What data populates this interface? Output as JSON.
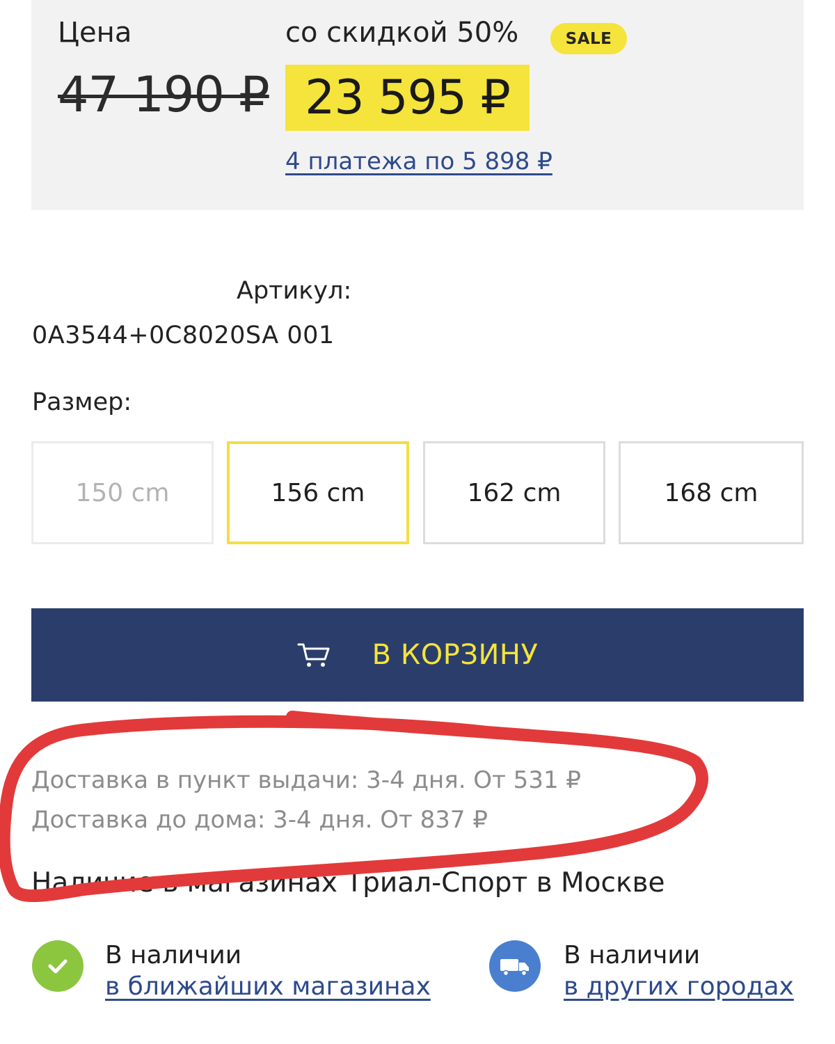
{
  "price": {
    "label": "Цена",
    "old": "47 190 ₽",
    "discount_label": "со скидкой 50%",
    "sale_badge": "SALE",
    "new": "23 595 ₽",
    "installment": "4 платежа по 5 898 ₽"
  },
  "sku": {
    "label": "Артикул:",
    "value": "0A3544+0C8020SA 001"
  },
  "sizes": {
    "label": "Размер:",
    "options": [
      {
        "label": "150 cm",
        "state": "unavailable"
      },
      {
        "label": "156 cm",
        "state": "selected"
      },
      {
        "label": "162 cm",
        "state": "available"
      },
      {
        "label": "168 cm",
        "state": "available"
      }
    ]
  },
  "cart": {
    "label": "В КОРЗИНУ",
    "icon": "cart-icon"
  },
  "delivery": {
    "pickup": "Доставка в пункт выдачи: 3-4 дня. От 531 ₽",
    "home": "Доставка до дома: 3-4 дня. От 837 ₽"
  },
  "stores_heading": "Наличие в магазинах Триал-Спорт в Москве",
  "availability": [
    {
      "icon": "check-circle-icon",
      "title": "В наличии",
      "link": "в ближайших магазинах"
    },
    {
      "icon": "delivery-truck-icon",
      "title": "В наличии",
      "link": "в других городах"
    }
  ],
  "colors": {
    "accent_yellow": "#f5e43b",
    "button_navy": "#2b3e6b",
    "link_blue": "#2e4a8c",
    "annotation_red": "#e23a3a",
    "check_green": "#8cc63f",
    "truck_blue": "#4a7fcf"
  }
}
